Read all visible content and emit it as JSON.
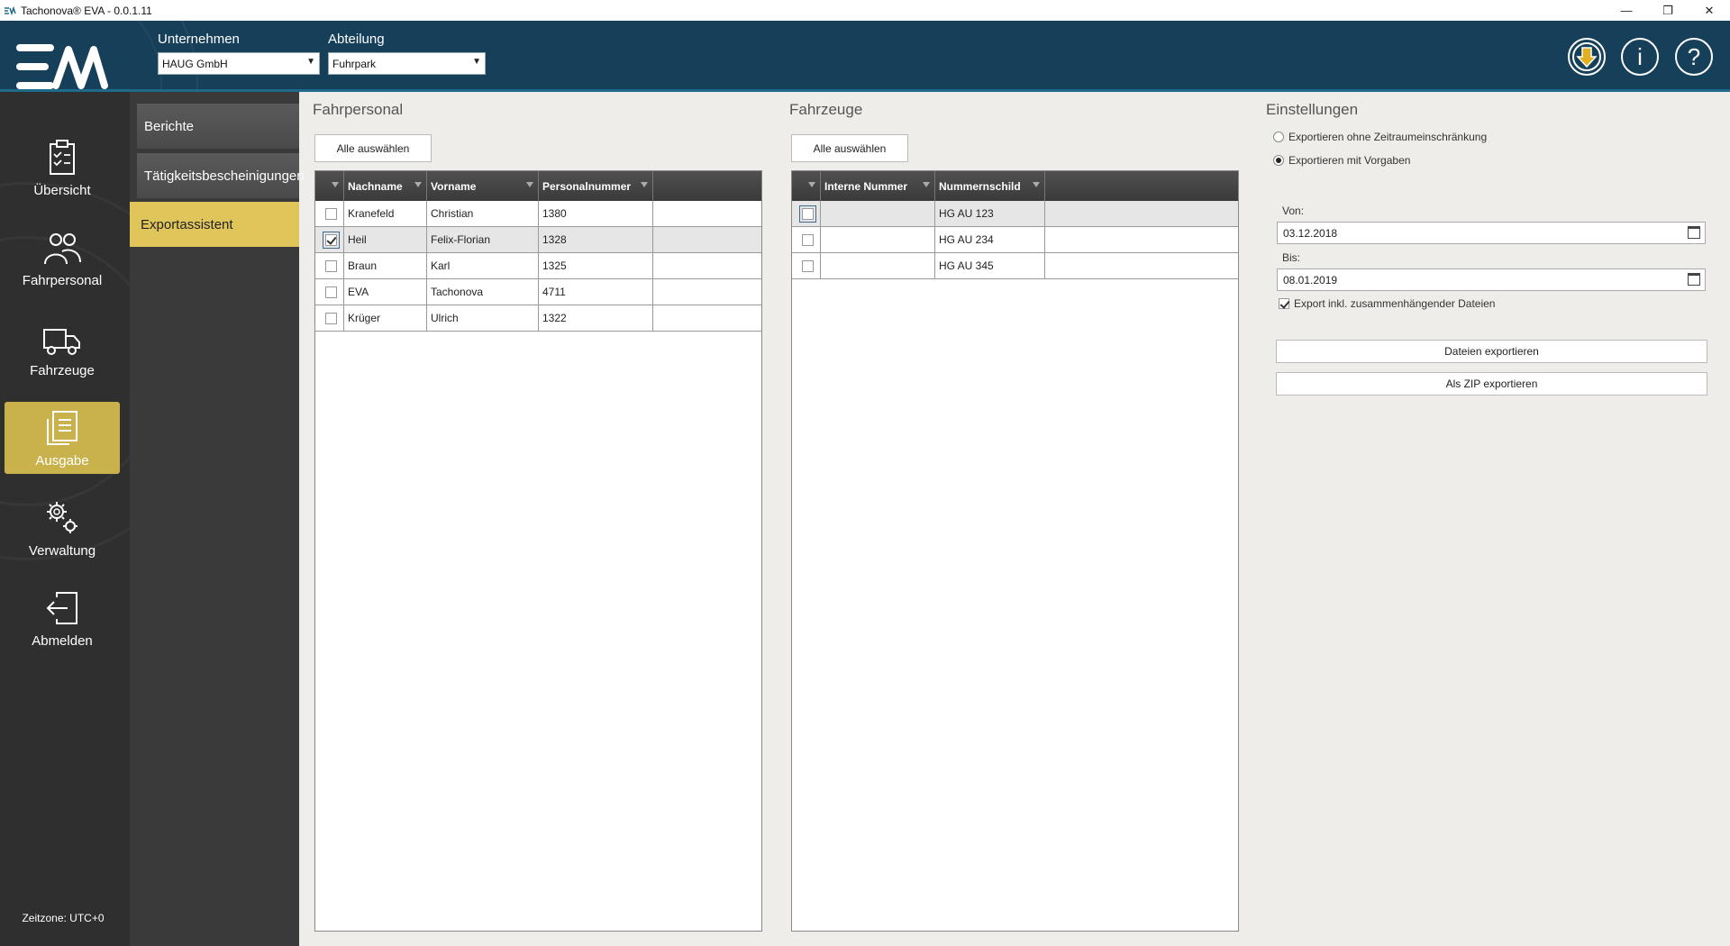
{
  "window": {
    "title": "Tachonova® EVA - 0.0.1.11",
    "controls": [
      "—",
      "❐",
      "✕"
    ]
  },
  "header": {
    "company_label": "Unternehmen",
    "company_value": "HAUG GmbH",
    "department_label": "Abteilung",
    "department_value": "Fuhrpark",
    "icons": [
      "download-icon",
      "info-icon",
      "help-icon"
    ],
    "info_glyph": "i",
    "help_glyph": "?"
  },
  "sidebar": {
    "items": [
      {
        "label": "Übersicht",
        "icon": "clipboard-icon"
      },
      {
        "label": "Fahrpersonal",
        "icon": "people-icon"
      },
      {
        "label": "Fahrzeuge",
        "icon": "truck-icon"
      },
      {
        "label": "Ausgabe",
        "icon": "document-icon",
        "active": true
      },
      {
        "label": "Verwaltung",
        "icon": "gears-icon"
      },
      {
        "label": "Abmelden",
        "icon": "logout-icon"
      }
    ],
    "timezone": "Zeitzone: UTC+0"
  },
  "subnav": {
    "items": [
      {
        "label": "Berichte"
      },
      {
        "label": "Tätigkeitsbescheinigungen"
      },
      {
        "label": "Exportassistent",
        "active": true
      }
    ]
  },
  "personnel": {
    "title": "Fahrpersonal",
    "select_all": "Alle auswählen",
    "columns": [
      "Nachname",
      "Vorname",
      "Personalnummer"
    ],
    "rows": [
      {
        "checked": false,
        "nachname": "Kranefeld",
        "vorname": "Christian",
        "nr": "1380"
      },
      {
        "checked": true,
        "nachname": "Heil",
        "vorname": "Felix-Florian",
        "nr": "1328"
      },
      {
        "checked": false,
        "nachname": "Braun",
        "vorname": "Karl",
        "nr": "1325"
      },
      {
        "checked": false,
        "nachname": "EVA",
        "vorname": "Tachonova",
        "nr": "4711"
      },
      {
        "checked": false,
        "nachname": "Krüger",
        "vorname": "Ulrich",
        "nr": "1322"
      }
    ]
  },
  "vehicles": {
    "title": "Fahrzeuge",
    "select_all": "Alle auswählen",
    "columns": [
      "Interne Nummer",
      "Nummernschild"
    ],
    "rows": [
      {
        "checked": false,
        "intern": "",
        "schild": "HG AU 123"
      },
      {
        "checked": false,
        "intern": "",
        "schild": "HG AU 234"
      },
      {
        "checked": false,
        "intern": "",
        "schild": "HG AU 345"
      }
    ]
  },
  "settings": {
    "title": "Einstellungen",
    "radio_no_range": "Exportieren ohne Zeitraumeinschränkung",
    "radio_with_defaults": "Exportieren mit Vorgaben",
    "selected_radio": "with_defaults",
    "from_label": "Von:",
    "from_value": "03.12.2018",
    "to_label": "Bis:",
    "to_value": "08.01.2019",
    "include_related_label": "Export inkl. zusammenhängender Dateien",
    "include_related_checked": true,
    "export_files_button": "Dateien exportieren",
    "export_zip_button": "Als ZIP exportieren"
  },
  "colors": {
    "header_bg": "#163f5a",
    "sidebar_bg": "#2f2f2f",
    "active_accent": "#c9b24b",
    "subnav_active": "#e0c55a"
  }
}
